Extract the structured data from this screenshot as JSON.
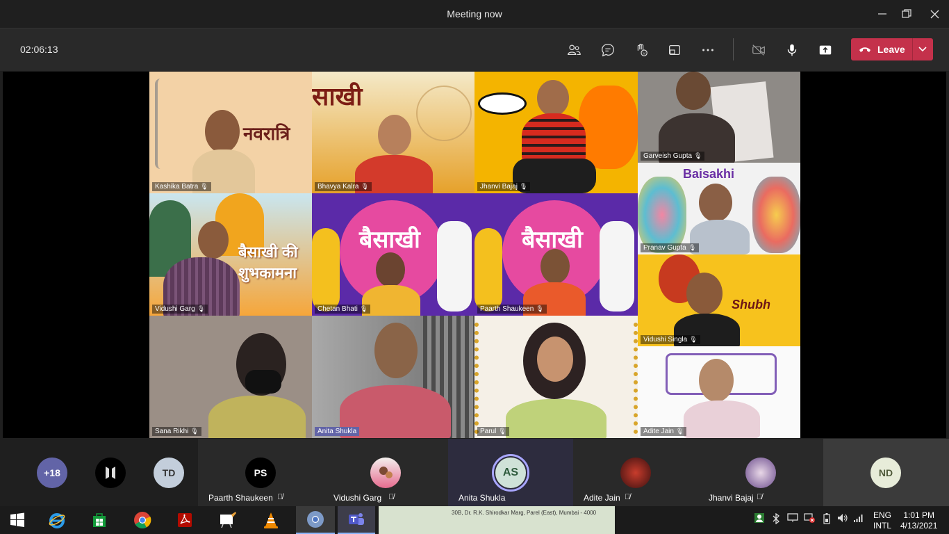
{
  "window": {
    "title": "Meeting now"
  },
  "toolbar": {
    "timer": "02:06:13",
    "leave_label": "Leave"
  },
  "tiles": [
    {
      "name": "Kashika Batra",
      "banner": "नवरात्रि"
    },
    {
      "name": "Bhavya Kalra",
      "banner": "साखी"
    },
    {
      "name": "Jhanvi Bajaj"
    },
    {
      "name": "Garveish Gupta"
    },
    {
      "name": "Vidushi Garg",
      "banner": "बैसाखी की शुभकामना"
    },
    {
      "name": "Chetan  Bhati",
      "banner": "बैसाखी"
    },
    {
      "name": "Paarth Shaukeen",
      "banner": "बैसाखी"
    },
    {
      "name": "Pranav Gupta",
      "banner": "Baisakhi"
    },
    {
      "name": "Vidushi Singla",
      "banner": "Shubh"
    },
    {
      "name": "Sana Rikhi"
    },
    {
      "name": "Anita Shukla"
    },
    {
      "name": "Parul"
    },
    {
      "name": "Adite Jain"
    }
  ],
  "strip": {
    "overflow": "+18",
    "td_initials": "TD",
    "nd_initials": "ND",
    "people": [
      {
        "name": "Paarth Shaukeen",
        "initials": "PS"
      },
      {
        "name": "Vidushi Garg",
        "initials": ""
      },
      {
        "name": "Anita Shukla",
        "initials": "AS"
      },
      {
        "name": "Adite Jain",
        "initials": ""
      },
      {
        "name": "Jhanvi Bajaj",
        "initials": ""
      }
    ]
  },
  "taskbar": {
    "address_text": "30B, Dr. R.K. Shirodkar Marg, Parel (East), Mumbai - 4000",
    "lang1": "ENG",
    "lang2": "INTL",
    "time": "1:01 PM",
    "date": "4/13/2021"
  },
  "colors": {
    "accent": "#6264a7",
    "leave": "#c4314b"
  }
}
